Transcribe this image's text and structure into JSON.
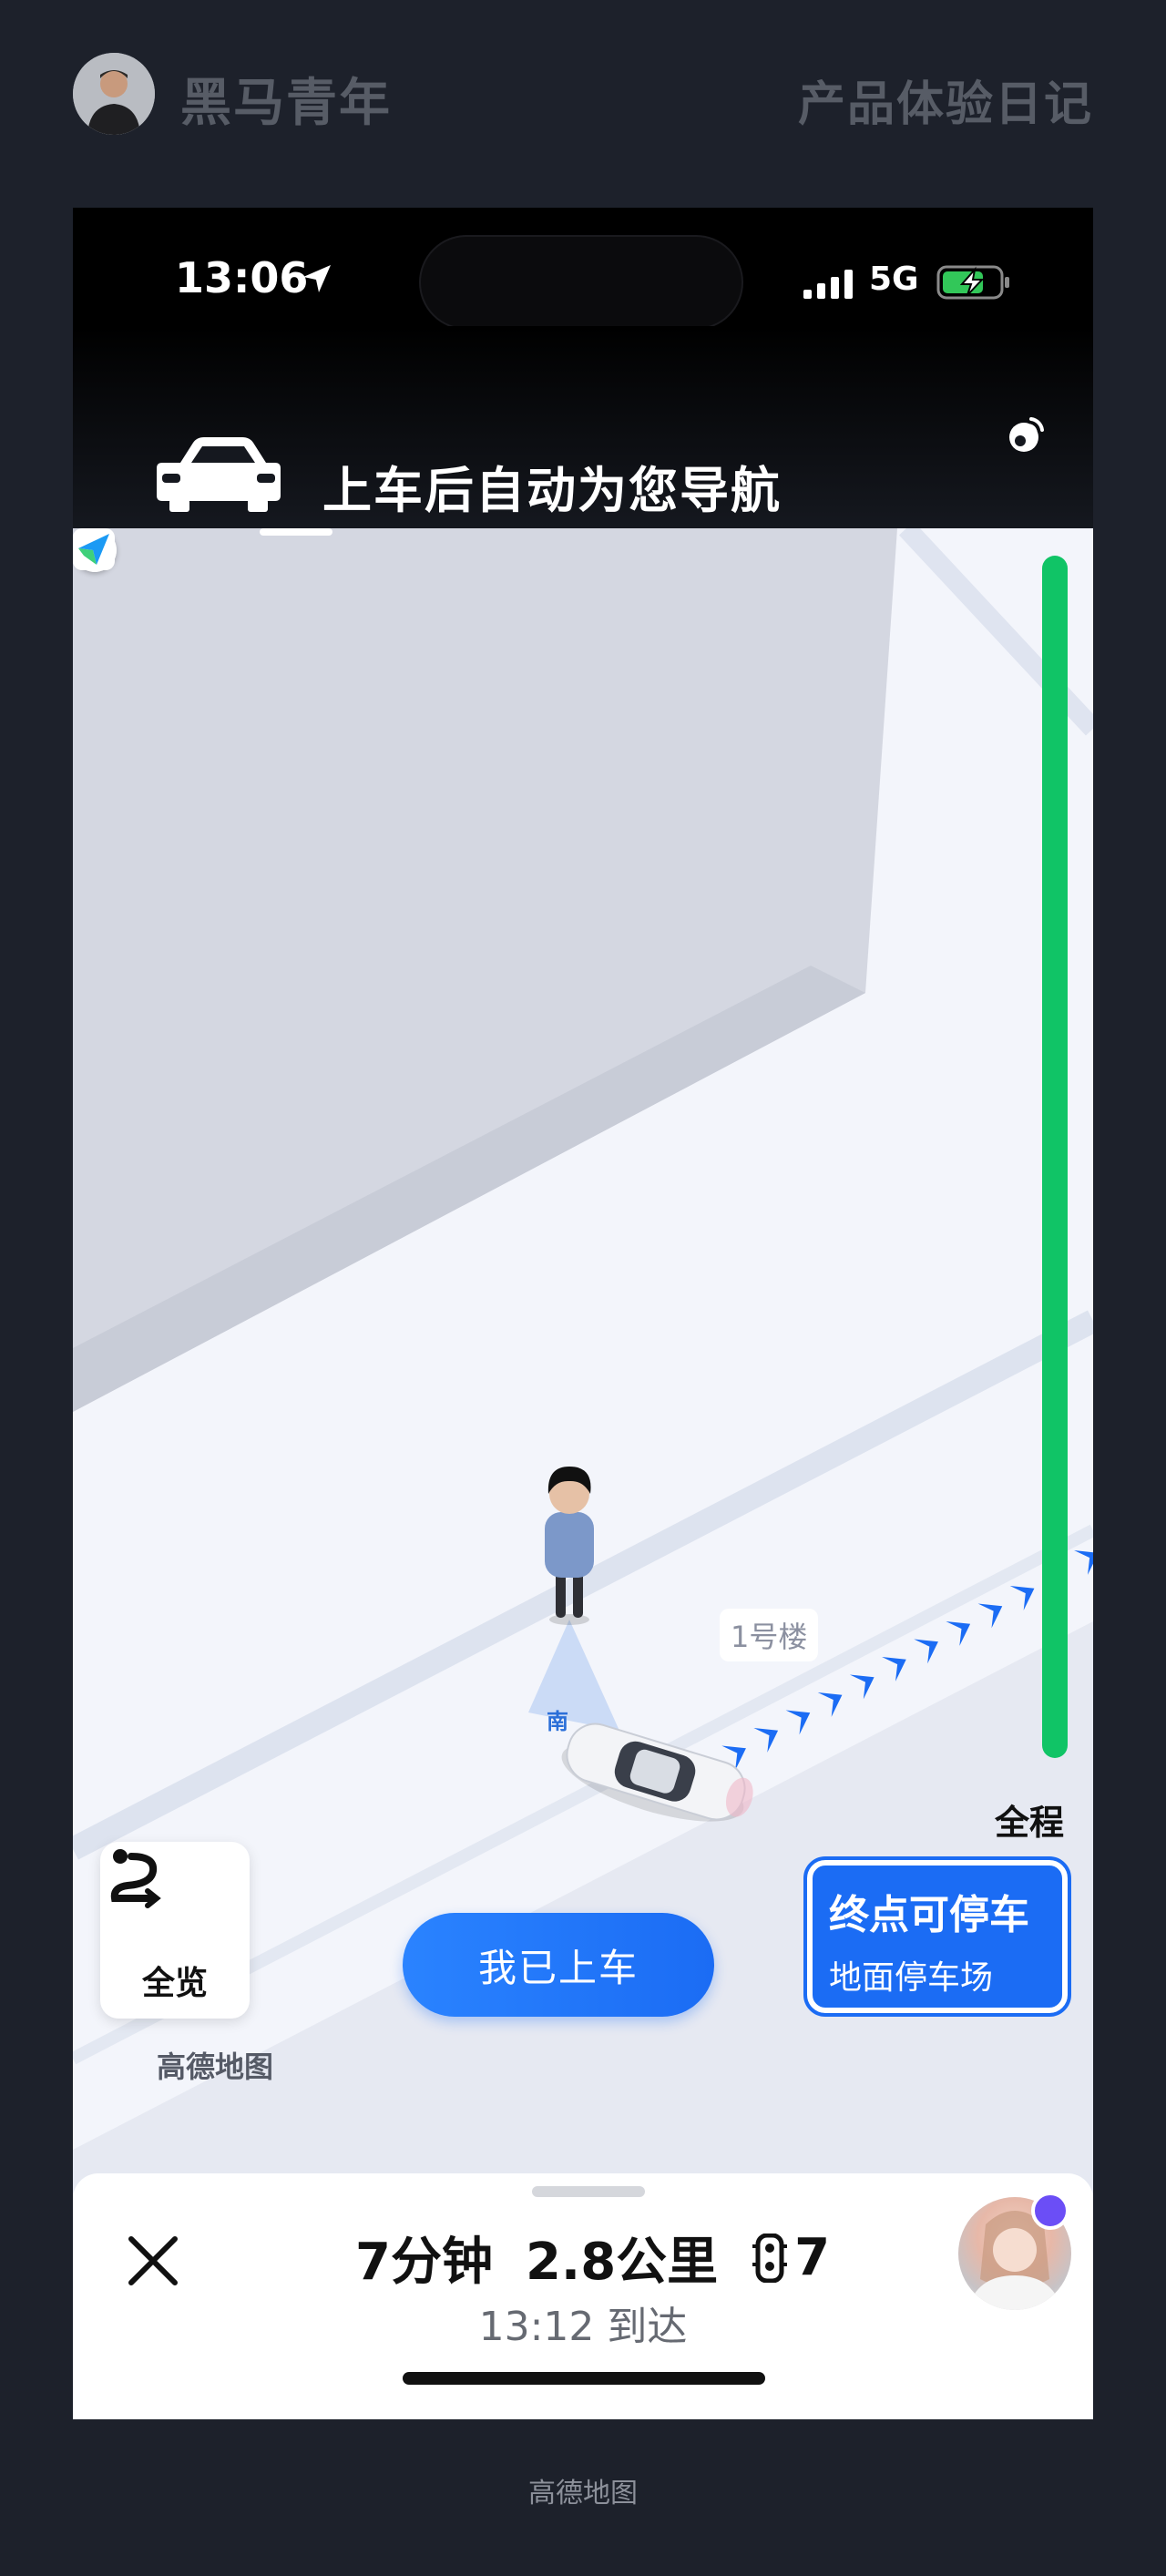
{
  "header": {
    "author": "黑马青年",
    "series": "产品体验日记"
  },
  "status_bar": {
    "time": "13:06",
    "network": "5G"
  },
  "nav_banner": {
    "message": "上车后自动为您导航"
  },
  "map": {
    "progress_label": "全程",
    "overview_label": "全览",
    "boarded_button": "我已上车",
    "parking": {
      "title": "终点可停车",
      "subtitle": "地面停车场"
    },
    "brand": "高德地图",
    "building_label": "1号楼",
    "direction_label": "南"
  },
  "trip": {
    "duration": "7分钟",
    "distance": "2.8公里",
    "traffic_lights": "7",
    "eta": "13:12 到达"
  },
  "footer": {
    "caption": "高德地图"
  },
  "colors": {
    "accent": "#1b6cf4",
    "progress": "#10c466",
    "background": "#1d212b"
  }
}
